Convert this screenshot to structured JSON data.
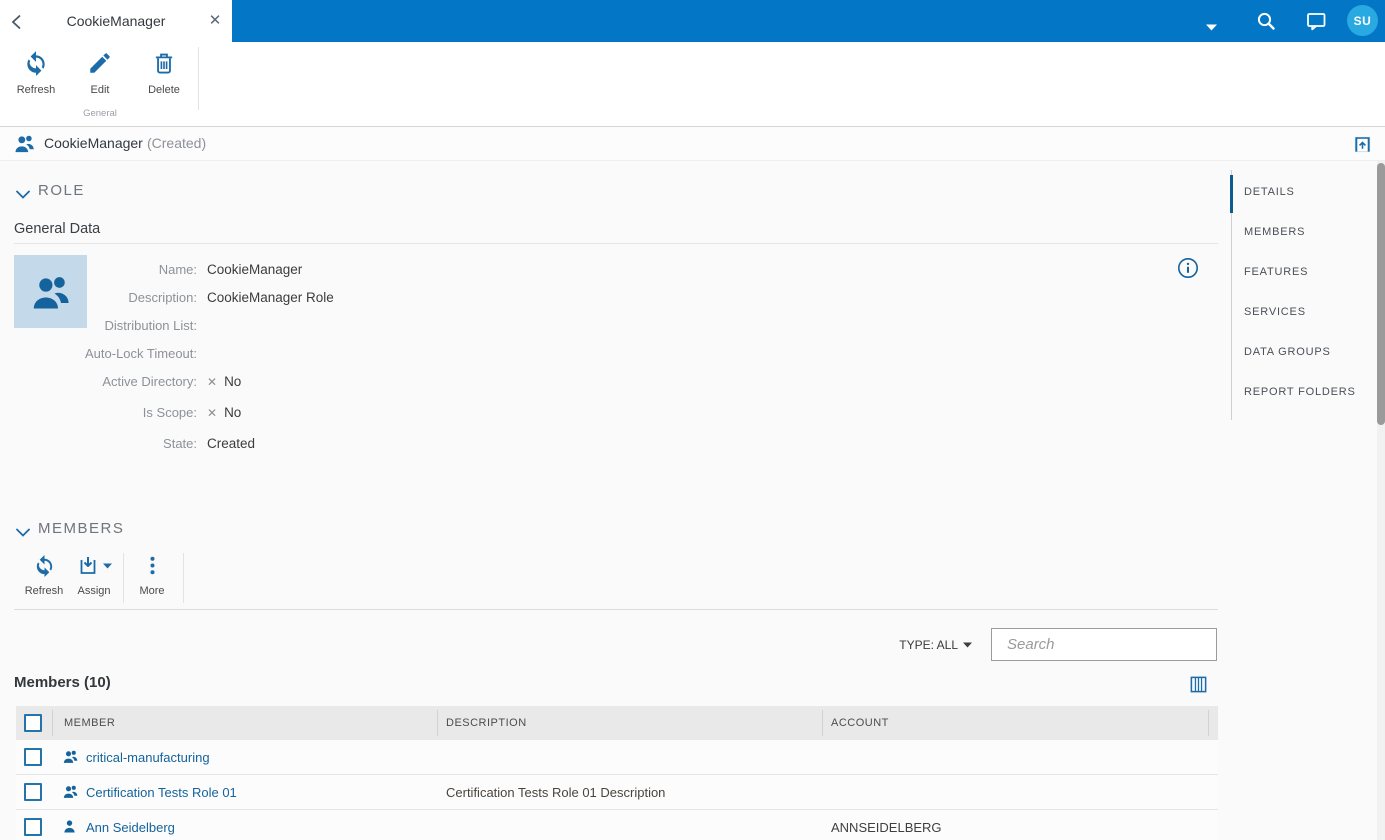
{
  "header": {
    "tab_title": "CookieManager",
    "avatar_initials": "SU"
  },
  "ribbon": {
    "refresh_label": "Refresh",
    "edit_label": "Edit",
    "delete_label": "Delete",
    "group_label": "General"
  },
  "title_bar": {
    "title": "CookieManager",
    "state": "(Created)"
  },
  "role_section": {
    "heading": "ROLE",
    "subheading": "General Data",
    "fields": [
      {
        "label": "Name:",
        "value": "CookieManager"
      },
      {
        "label": "Description:",
        "value": "CookieManager Role"
      },
      {
        "label": "Distribution List:",
        "value": ""
      },
      {
        "label": "Auto-Lock Timeout:",
        "value": ""
      },
      {
        "label": "Active Directory:",
        "value": "No"
      },
      {
        "label": "Is Scope:",
        "value": "No"
      },
      {
        "label": "State:",
        "value": "Created"
      }
    ]
  },
  "nav": {
    "items": [
      {
        "label": "DETAILS"
      },
      {
        "label": "MEMBERS"
      },
      {
        "label": "FEATURES"
      },
      {
        "label": "SERVICES"
      },
      {
        "label": "DATA GROUPS"
      },
      {
        "label": "REPORT FOLDERS"
      }
    ],
    "active": "DETAILS"
  },
  "members_section": {
    "heading": "MEMBERS",
    "toolbar": {
      "refresh_label": "Refresh",
      "assign_label": "Assign",
      "more_label": "More"
    },
    "type_filter": "TYPE: ALL",
    "search_placeholder": "Search",
    "table_title": "Members (10)",
    "columns": [
      {
        "label": "MEMBER"
      },
      {
        "label": "DESCRIPTION"
      },
      {
        "label": "ACCOUNT"
      }
    ],
    "rows": [
      {
        "member": "critical-manufacturing",
        "description": "",
        "account": "",
        "type": "role"
      },
      {
        "member": "Certification Tests Role 01",
        "description": "Certification Tests Role 01 Description",
        "account": "",
        "type": "role"
      },
      {
        "member": "Ann Seidelberg",
        "description": "",
        "account": "ANNSEIDELBERG",
        "type": "user"
      }
    ]
  },
  "icons": {
    "x_mark": "✕",
    "close": "✕"
  },
  "colors": {
    "topbar_blue": "#0377c5",
    "icon_blue": "#1b6ca8",
    "link_blue": "#15639c",
    "avatar_blue": "#29a9e1",
    "table_header_bg": "#e9e9e9"
  }
}
